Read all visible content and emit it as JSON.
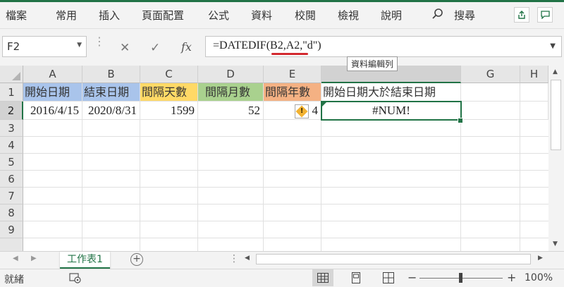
{
  "ribbon": {
    "tabs": [
      "檔案",
      "常用",
      "插入",
      "頁面配置",
      "公式",
      "資料",
      "校閱",
      "檢視",
      "說明"
    ],
    "search_label": "搜尋"
  },
  "formula_bar": {
    "name_box": "F2",
    "formula": "=DATEDIF(B2,A2,\"d\")",
    "tooltip": "資料編輯列"
  },
  "grid": {
    "columns": [
      "A",
      "B",
      "C",
      "D",
      "E",
      "F",
      "G",
      "H"
    ],
    "rows": [
      "1",
      "2",
      "3",
      "4",
      "5",
      "6",
      "7",
      "8",
      "9"
    ],
    "active_cell": "F2",
    "header_row": [
      {
        "text": "開始日期",
        "color": "#a9c4eb"
      },
      {
        "text": "結束日期",
        "color": "#a9c4eb"
      },
      {
        "text": "間隔天數",
        "color": "#ffd966"
      },
      {
        "text": "間隔月數",
        "color": "#a9d18e"
      },
      {
        "text": "間隔年數",
        "color": "#f4b183"
      },
      {
        "text": "開始日期大於結束日期",
        "color": "#ffffff"
      }
    ],
    "data_row": [
      "2016/4/15",
      "2020/8/31",
      "1599",
      "52",
      "4",
      "#NUM!"
    ]
  },
  "sheets": {
    "active": "工作表1"
  },
  "status": {
    "ready": "就緒",
    "zoom": "100%"
  },
  "colors": {
    "accent": "#217346",
    "error_underline": "#d3292f"
  }
}
